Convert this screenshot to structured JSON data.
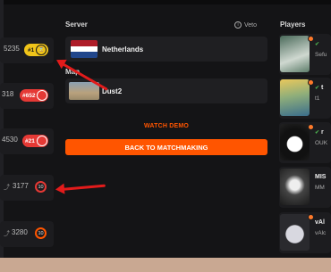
{
  "left_cards": [
    {
      "elo": "5235",
      "badge": "#1",
      "level": "",
      "badge_color": "#f0c419"
    },
    {
      "elo": "318",
      "badge": "#652",
      "level": "",
      "badge_color": "#e53935"
    },
    {
      "elo": "4530",
      "badge": "#21",
      "level": "",
      "badge_color": "#e53935"
    },
    {
      "elo": "3177",
      "badge": "",
      "level": "10",
      "badge_color": ""
    },
    {
      "elo": "3280",
      "badge": "",
      "level": "10",
      "badge_color": ""
    }
  ],
  "server": {
    "heading": "Server",
    "veto": "Veto",
    "name": "Netherlands"
  },
  "map": {
    "heading": "Map",
    "name": "Dust2"
  },
  "actions": {
    "watch_demo": "WATCH DEMO",
    "back": "BACK TO MATCHMAKING"
  },
  "players": {
    "heading": "Players",
    "items": [
      {
        "name": "",
        "sub": "Sefu"
      },
      {
        "name": "t",
        "sub": "t1"
      },
      {
        "name": "r",
        "sub": "OUK"
      },
      {
        "name": "MIS",
        "sub": "MM"
      },
      {
        "name": "vAl",
        "sub": "vAlc"
      }
    ]
  },
  "colors": {
    "accent": "#ff5500",
    "gold": "#f0c419",
    "red": "#e53935",
    "annotation": "#e21b1b"
  }
}
